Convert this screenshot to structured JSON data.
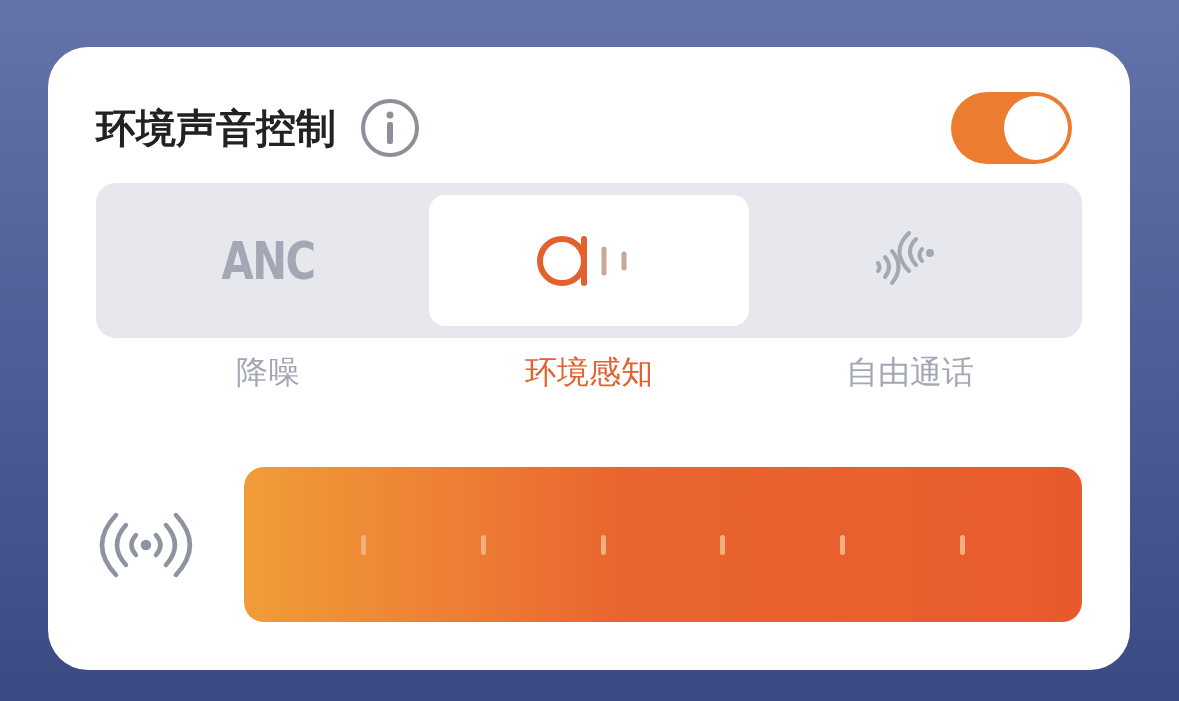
{
  "header": {
    "title": "环境声音控制",
    "enabled": true
  },
  "modes": [
    {
      "kind": "anc",
      "icon_text": "ANC",
      "label": "降噪",
      "selected": false
    },
    {
      "kind": "ambient",
      "label": "环境感知",
      "selected": true
    },
    {
      "kind": "conversation",
      "label": "自由通话",
      "selected": false
    }
  ],
  "ambient_slider": {
    "level": 1
  }
}
